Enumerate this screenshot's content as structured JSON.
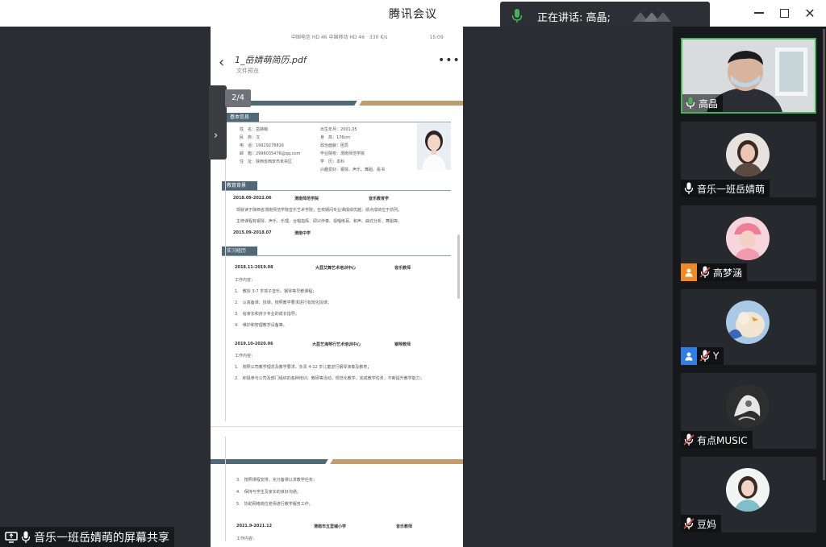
{
  "app": {
    "title": "腾讯会议"
  },
  "speaking": {
    "text": "正在讲话: 高晶;"
  },
  "doc": {
    "phone_status_left": "中国电信 HD 46 中国移动 HD 46",
    "phone_status_speed": "330 K/s",
    "phone_status_time": "15:09",
    "title": "1_岳婧萌简历.pdf",
    "subtitle": "文件预览",
    "page_counter": "2/4"
  },
  "resume": {
    "sections": {
      "basic": "基本信息",
      "education": "教育背景",
      "internship": "实习经历"
    },
    "basic_left": [
      "姓　名：岳婧萌",
      "民　族：汉",
      "电　话：19929278816",
      "邮　箱：2996035476@qq.com",
      "住　址：陕西省西安市未央区"
    ],
    "basic_right": [
      "出生年月：2001.05",
      "身　高：176cm",
      "政治面貌：团员",
      "毕业院校：渭南师范学院",
      "学　历：本科",
      "兴趣爱好：钢琴、声乐、舞蹈、看书"
    ],
    "education": {
      "row1_date": "2018.09-2022.06",
      "row1_school": "渭南师范学院",
      "row1_major": "音乐教育学",
      "desc1": "现就读于陕西省渭南师范学院音乐艺术学院，在校期间专业课成绩优越，绩点成绩位于前列。",
      "desc2": "主修课程有钢琴、声乐、乐理、合唱指挥、即兴伴奏、视唱练耳、和声、曲式分析、舞蹈等。",
      "row2_date": "2015.09-2018.07",
      "row2_school": "渭南中学"
    },
    "internship": {
      "job1_date": "2018.11-2019.08",
      "job1_company": "大荔艾舞艺术培训中心",
      "job1_role": "音乐教师",
      "job1_content": "工作内容：",
      "job1_items": [
        "1.　教授 3-7 岁孩子音乐、钢琴等早教课程；",
        "2.　认真备课、授课，按照教学要求进行有效化授课；",
        "3.　给家长和孩子专业的成长指导；",
        "4.　维护和管理教学设备等。"
      ],
      "job2_date": "2019.10-2020.06",
      "job2_company": "大荔艺海琴行艺术培训中心",
      "job2_role": "钢琴教师",
      "job2_content": "工作内容：",
      "job2_items": [
        "1.　按照公司教学理念及教学要求，负责 4-12 岁儿童进行钢琴演奏及教育；",
        "2.　积极参与公司及部门组织的各种培训、教研等活动，规范化教学，完成教学任务，不断提升教学能力；"
      ]
    },
    "page2": {
      "items": [
        "3.　按照课程安排，充分备课以求教学任务；",
        "4.　保持与学生及家长的良好沟通；",
        "5.　协助网络岗位老师进行教学服务工作。"
      ],
      "job3_date": "2021.9-2021.12",
      "job3_company": "渭南市五里铺小学",
      "job3_role": "音乐教师",
      "job3_content": "工作内容："
    }
  },
  "share_label": "音乐一班岳婧萌的屏幕共享",
  "participants": [
    {
      "name": "高晶",
      "mic": "on",
      "role": "none",
      "speaking": true
    },
    {
      "name": "音乐一班岳婧萌",
      "mic": "on",
      "role": "none"
    },
    {
      "name": "高梦涵",
      "mic": "muted",
      "role": "host"
    },
    {
      "name": "Y",
      "mic": "muted",
      "role": "cohost"
    },
    {
      "name": "有点MUSIC",
      "mic": "muted",
      "role": "none"
    },
    {
      "name": "豆妈",
      "mic": "muted",
      "role": "none"
    }
  ],
  "colors": {
    "speaking_green": "#47b25b",
    "host_orange": "#f08a24",
    "cohost_blue": "#2f7ee6",
    "resume_dark": "#4f6a76",
    "resume_gold": "#c49b6b"
  }
}
